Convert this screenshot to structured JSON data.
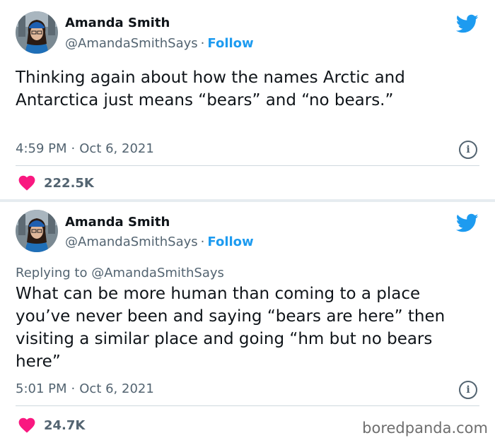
{
  "tweets": [
    {
      "name": "Amanda Smith",
      "handle": "@AmandaSmithSays",
      "separator": "·",
      "follow": "Follow",
      "text": "Thinking again about how the names Arctic and Antarctica just means “bears” and “no bears.”",
      "time": "4:59 PM",
      "date": "Oct 6, 2021",
      "likes": "222.5K"
    },
    {
      "name": "Amanda Smith",
      "handle": "@AmandaSmithSays",
      "separator": "·",
      "follow": "Follow",
      "reply_prefix": "Replying to",
      "reply_to": "@AmandaSmithSays",
      "text": "What can be more human than coming to a place you’ve never been and saying “bears are here” then visiting a similar place and going “hm but no bears here”",
      "time": "5:01 PM",
      "date": "Oct 6, 2021",
      "likes": "24.7K"
    }
  ],
  "icons": {
    "brand": "twitter-bird-icon",
    "like": "heart-icon",
    "info": "info-icon"
  },
  "colors": {
    "twitter_blue": "#1d9bf0",
    "heart": "#f91880",
    "secondary_text": "#536471"
  },
  "watermark": "boredpanda.com"
}
